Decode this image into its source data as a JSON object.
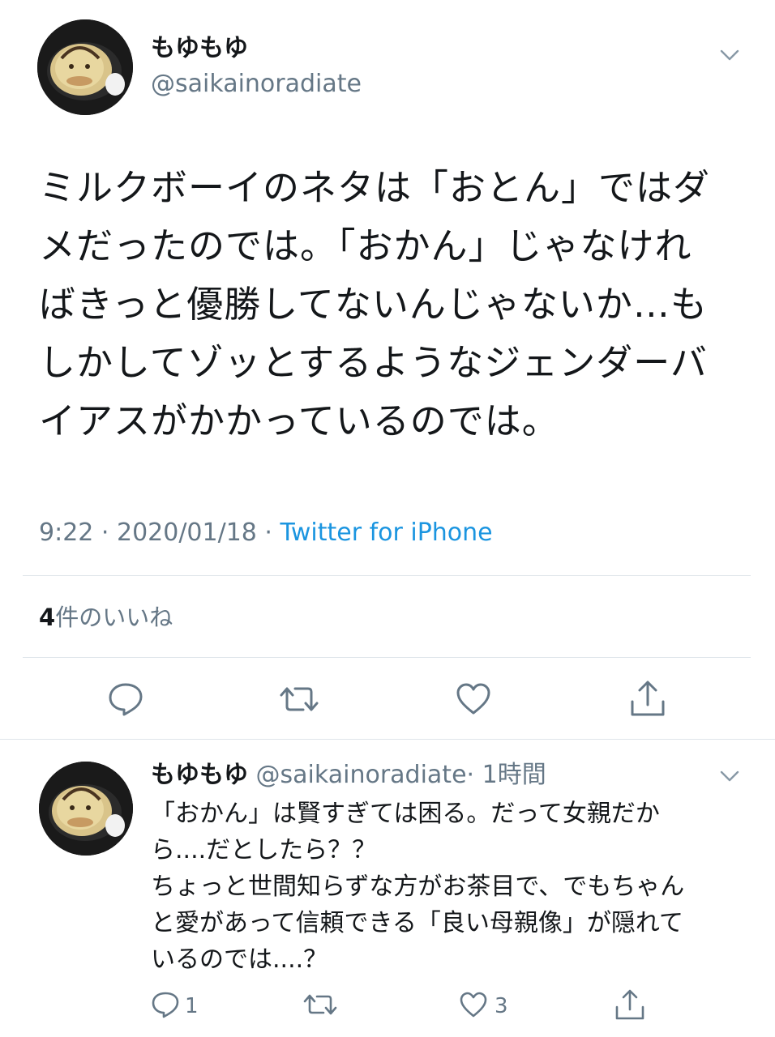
{
  "tweet": {
    "display_name": "もゆもゆ",
    "handle": "@saikainoradiate",
    "body_lines": [
      "ミルクボーイのネタは「おとん」ではダ",
      "メだったのでは。「おかん」じゃなけれ",
      "ばきっと優勝してないんじゃないか…も",
      "しかしてゾッとするようなジェンダーバ",
      "イアスがかかっているのでは。"
    ],
    "timestamp": "9:22 · 2020/01/18 · ",
    "source": "Twitter for iPhone",
    "likes_count": "4",
    "likes_label": "件のいいね"
  },
  "reply": {
    "display_name": "もゆもゆ",
    "handle": "@saikainoradiate",
    "time": "· 1時間",
    "body_lines": [
      "「おかん」は賢すぎては困る。だって女親だか",
      "ら....だとしたら？？",
      "ちょっと世間知らずな方がお茶目で、でもちゃん",
      "と愛があって信頼できる「良い母親像」が隠れて",
      "いるのでは....？"
    ],
    "reply_count": "1",
    "like_count": "3"
  },
  "colors": {
    "text": "#14171a",
    "secondary": "#657786",
    "link": "#1b95e0",
    "divider": "#dfe5ea"
  },
  "icons": [
    "chevron-down-icon",
    "reply-icon",
    "retweet-icon",
    "like-icon",
    "share-icon"
  ]
}
